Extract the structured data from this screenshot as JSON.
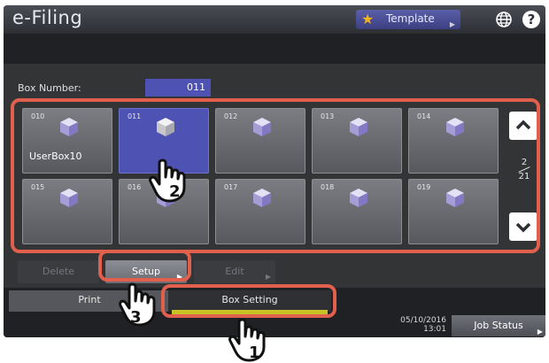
{
  "app": {
    "title": "e-Filing"
  },
  "header": {
    "template_label": "Template",
    "icons": [
      "star-icon",
      "globe-icon",
      "help-icon"
    ]
  },
  "box_number": {
    "label": "Box Number:",
    "value": "011"
  },
  "boxes": [
    {
      "number": "010",
      "name": "UserBox10",
      "selected": false
    },
    {
      "number": "011",
      "name": "",
      "selected": true
    },
    {
      "number": "012",
      "name": "",
      "selected": false
    },
    {
      "number": "013",
      "name": "",
      "selected": false
    },
    {
      "number": "014",
      "name": "",
      "selected": false
    },
    {
      "number": "015",
      "name": "",
      "selected": false
    },
    {
      "number": "016",
      "name": "",
      "selected": false
    },
    {
      "number": "017",
      "name": "",
      "selected": false
    },
    {
      "number": "018",
      "name": "",
      "selected": false
    },
    {
      "number": "019",
      "name": "",
      "selected": false
    }
  ],
  "pager": {
    "current": "2",
    "total": "21"
  },
  "actions": {
    "delete": "Delete",
    "setup": "Setup",
    "edit": "Edit"
  },
  "tabs": {
    "print": "Print",
    "box_setting": "Box Setting"
  },
  "status": {
    "date": "05/10/2016",
    "time": "13:01",
    "job_status": "Job Status"
  },
  "callouts": [
    "1",
    "2",
    "3"
  ],
  "colors": {
    "accent": "#4d52b3",
    "highlight": "#e1604d",
    "tab_underline": "#c9c227"
  }
}
